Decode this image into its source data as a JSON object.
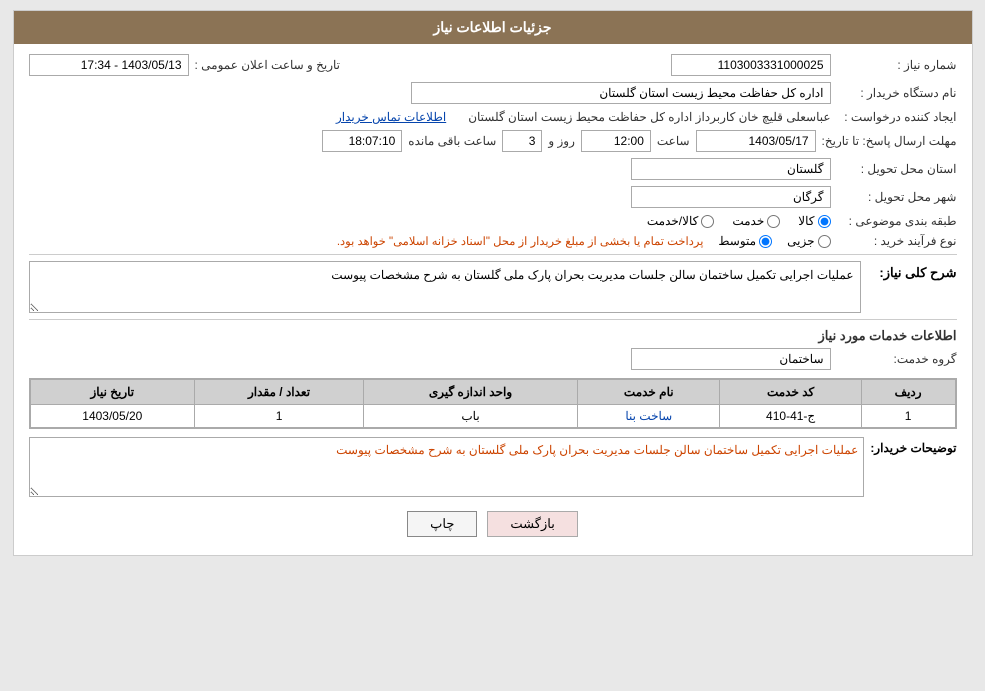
{
  "header": {
    "title": "جزئیات اطلاعات نیاز"
  },
  "fields": {
    "need_number_label": "شماره نیاز :",
    "need_number_value": "1103003331000025",
    "buyer_org_label": "نام دستگاه خریدار :",
    "buyer_org_value": "اداره کل حفاظت محیط زیست استان گلستان",
    "creator_label": "ایجاد کننده درخواست :",
    "creator_value": "عباسعلی  قلیچ خان  کاربرداز اداره کل حفاظت محیط زیست استان گلستان",
    "contact_link": "اطلاعات تماس خریدار",
    "deadline_label": "مهلت ارسال پاسخ: تا تاریخ:",
    "deadline_date": "1403/05/17",
    "deadline_time_label": "ساعت",
    "deadline_time": "12:00",
    "deadline_days_label": "روز و",
    "deadline_days": "3",
    "deadline_remaining_label": "ساعت باقی مانده",
    "deadline_remaining": "18:07:10",
    "announce_label": "تاریخ و ساعت اعلان عمومی :",
    "announce_value": "1403/05/13 - 17:34",
    "province_label": "استان محل تحویل :",
    "province_value": "گلستان",
    "city_label": "شهر محل تحویل :",
    "city_value": "گرگان",
    "category_label": "طبقه بندی موضوعی :",
    "category_options": [
      "کالا",
      "خدمت",
      "کالا/خدمت"
    ],
    "category_selected": "کالا",
    "purchase_type_label": "نوع فرآیند خرید :",
    "purchase_types": [
      "جزیی",
      "متوسط"
    ],
    "purchase_selected": "متوسط",
    "purchase_note": "پرداخت تمام یا بخشی از مبلغ خریدار از محل \"اسناد خزانه اسلامی\" خواهد بود.",
    "need_desc_label": "شرح کلی نیاز:",
    "need_desc_value": "عملیات اجرایی تکمیل ساختمان سالن جلسات مدیریت بحران پارک ملی گلستان به شرح مشخصات پیوست",
    "services_section_title": "اطلاعات خدمات مورد نیاز",
    "service_group_label": "گروه خدمت:",
    "service_group_value": "ساختمان",
    "table": {
      "columns": [
        "ردیف",
        "کد خدمت",
        "نام خدمت",
        "واحد اندازه گیری",
        "تعداد / مقدار",
        "تاریخ نیاز"
      ],
      "rows": [
        {
          "index": "1",
          "service_code": "ج-41-410",
          "service_name": "ساخت بنا",
          "unit": "باب",
          "quantity": "1",
          "date": "1403/05/20"
        }
      ]
    },
    "buyer_desc_label": "توضیحات خریدار:",
    "buyer_desc_value": "عملیات اجرایی تکمیل ساختمان سالن جلسات مدیریت بحران پارک ملی گلستان به شرح مشخصات پیوست"
  },
  "buttons": {
    "print_label": "چاپ",
    "back_label": "بازگشت"
  }
}
